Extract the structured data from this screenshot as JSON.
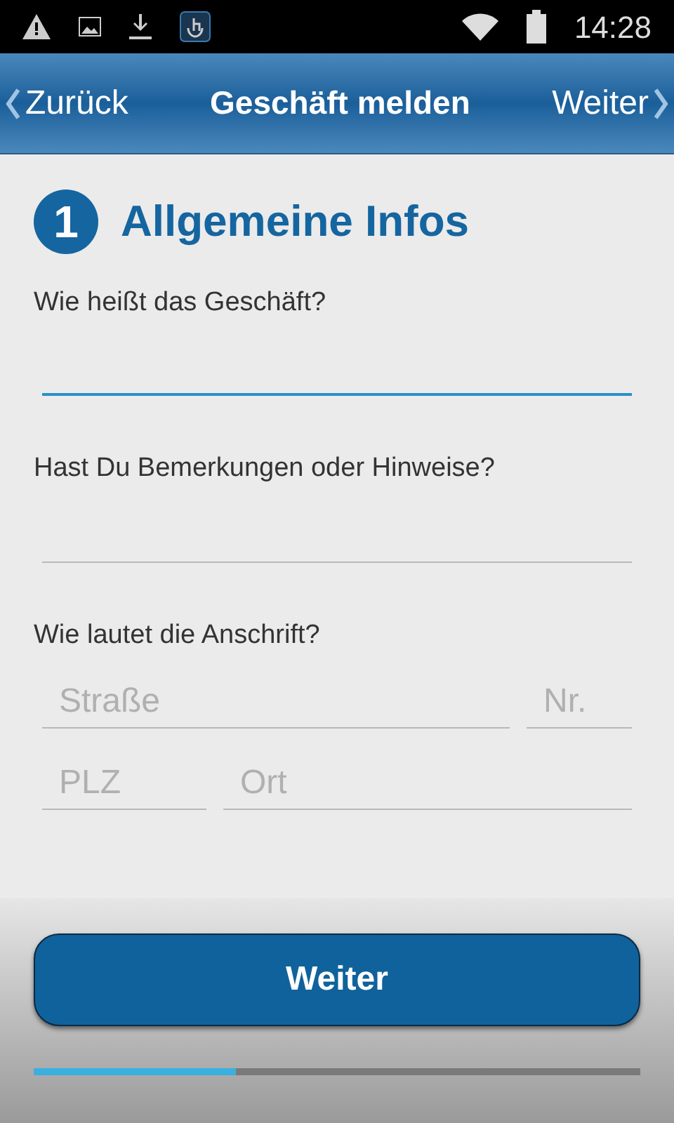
{
  "status_bar": {
    "time": "14:28"
  },
  "header": {
    "back": "Zurück",
    "title": "Geschäft melden",
    "next": "Weiter"
  },
  "section": {
    "number": "1",
    "title": "Allgemeine Infos"
  },
  "questions": [
    {
      "label": "Wie heißt das Geschäft?",
      "fields": [
        {
          "focused": true
        }
      ]
    },
    {
      "label": "Hast Du Bemerkungen oder Hinweise?",
      "fields": [
        {
          "focused": false
        }
      ]
    },
    {
      "label": "Wie lautet die Anschrift?",
      "rows": [
        [
          {
            "placeholder": "Straße",
            "focused": false
          },
          {
            "placeholder": "Nr.",
            "focused": false
          }
        ],
        [
          {
            "placeholder": "PLZ",
            "focused": false
          },
          {
            "placeholder": "Ort",
            "focused": false
          }
        ]
      ]
    }
  ],
  "button": "Weiter",
  "progress": {
    "level": 0.333
  }
}
